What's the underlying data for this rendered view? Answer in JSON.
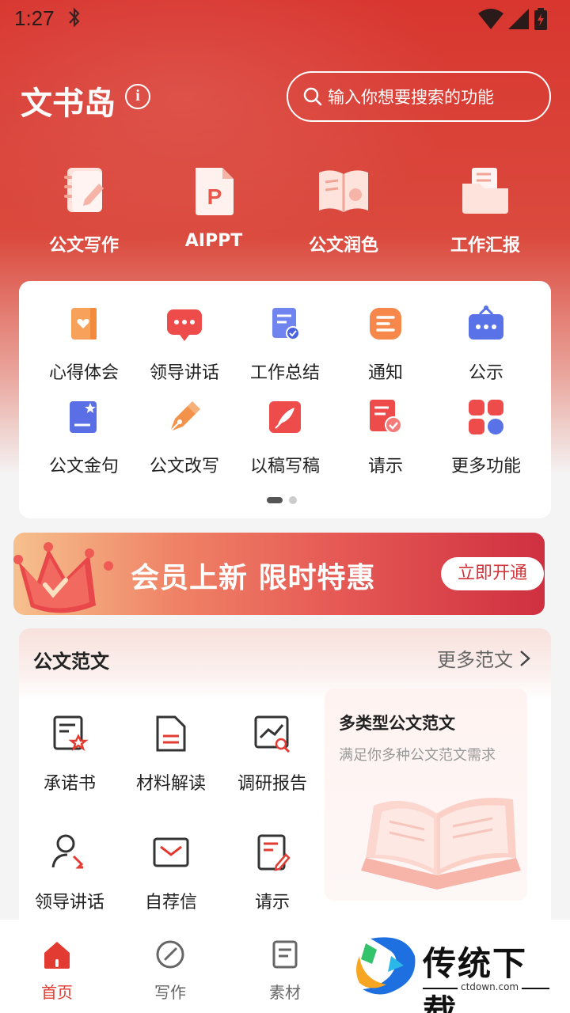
{
  "status_bar": {
    "time": "1:27",
    "bluetooth": "bluetooth-icon"
  },
  "header": {
    "title": "文书岛",
    "info_icon": "i",
    "search_placeholder": "输入你想要搜索的功能"
  },
  "top_features": [
    {
      "label": "公文写作",
      "icon": "notebook-pen-icon"
    },
    {
      "label": "AIPPT",
      "icon": "ppt-file-icon",
      "glyph": "P"
    },
    {
      "label": "公文润色",
      "icon": "open-book-icon"
    },
    {
      "label": "工作汇报",
      "icon": "folder-doc-icon"
    }
  ],
  "grid": {
    "items": [
      {
        "label": "心得体会",
        "color": "#f39a4a"
      },
      {
        "label": "领导讲话",
        "color": "#ee4b4b"
      },
      {
        "label": "工作总结",
        "color": "#5b73e8"
      },
      {
        "label": "通知",
        "color": "#f5884a"
      },
      {
        "label": "公示",
        "color": "#5a72e8"
      },
      {
        "label": "公文金句",
        "color": "#5a6ee6"
      },
      {
        "label": "公文改写",
        "color": "#f3924a"
      },
      {
        "label": "以稿写稿",
        "color": "#ee4b4b"
      },
      {
        "label": "请示",
        "color": "#ee4b4b"
      },
      {
        "label": "更多功能",
        "color": "#ee4b4b"
      }
    ],
    "page_indicator": {
      "current": 1,
      "total": 2
    }
  },
  "banner": {
    "text": "会员上新 限时特惠",
    "button": "立即开通"
  },
  "samples": {
    "title": "公文范文",
    "more": "更多范文",
    "items": [
      {
        "label": "承诺书"
      },
      {
        "label": "材料解读"
      },
      {
        "label": "调研报告"
      },
      {
        "label": "领导讲话"
      },
      {
        "label": "自荐信"
      },
      {
        "label": "请示"
      }
    ],
    "promo": {
      "title": "多类型公文范文",
      "subtitle": "满足你多种公文范文需求"
    }
  },
  "bottom_nav": [
    {
      "label": "首页",
      "active": true
    },
    {
      "label": "写作",
      "active": false
    },
    {
      "label": "素材",
      "active": false
    }
  ],
  "watermark": {
    "text": "传统下载",
    "url": "ctdown.com"
  },
  "colors": {
    "brand_red": "#d8362f",
    "accent": "#e23b32"
  }
}
